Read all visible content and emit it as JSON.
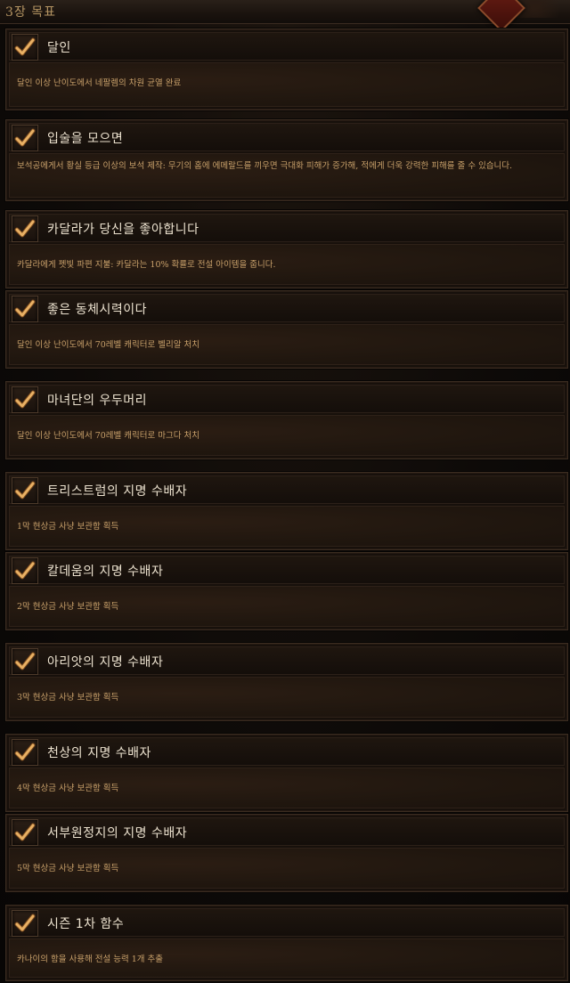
{
  "header": {
    "title": "3장 목표"
  },
  "objectives": [
    {
      "title": "달인",
      "description": "달인 이상 난이도에서 네팔렘의 차원 균열 완료",
      "completed": true,
      "check_icon": "check-icon"
    },
    {
      "title": "입술을 모으면",
      "description": "보석공에게서 황실 등급 이상의 보석 제작: 무기의 홈에 에메랄드를 끼우면 극대화 피해가 증가해, 적에게 더욱 강력한 피해를 줄 수 있습니다.",
      "completed": true,
      "check_icon": "check-icon"
    },
    {
      "title": "카달라가 당신을 좋아합니다",
      "description": "카달라에게 펫빛 파편 지불: 카달라는 10% 확률로 전설 아이템을 줍니다.",
      "completed": true,
      "check_icon": "check-icon"
    },
    {
      "title": "좋은 동체시력이다",
      "description": "달인 이상 난이도에서 70레벨 캐릭터로 벨리알 처치",
      "completed": true,
      "check_icon": "check-icon"
    },
    {
      "title": "마녀단의 우두머리",
      "description": "달인 이상 난이도에서 70레벨 캐릭터로 마그다 처치",
      "completed": true,
      "check_icon": "check-icon"
    },
    {
      "title": "트리스트럼의 지명 수배자",
      "description": "1막 현상금 사냥 보관함 획득",
      "completed": true,
      "check_icon": "check-icon"
    },
    {
      "title": "칼데움의 지명 수배자",
      "description": "2막 현상금 사냥 보관함 획득",
      "completed": true,
      "check_icon": "check-icon"
    },
    {
      "title": "아리앗의 지명 수배자",
      "description": "3막 현상금 사냥 보관함 획득",
      "completed": true,
      "check_icon": "check-icon"
    },
    {
      "title": "천상의 지명 수배자",
      "description": "4막 현상금 사냥 보관함 획득",
      "completed": true,
      "check_icon": "check-icon"
    },
    {
      "title": "서부원정지의 지명 수배자",
      "description": "5막 현상금 사냥 보관함 획득",
      "completed": true,
      "check_icon": "check-icon"
    },
    {
      "title": "시즌 1차 함수",
      "description": "카나이의 함을 사용해 전설 능력 1개 추출",
      "completed": true,
      "check_icon": "check-icon"
    }
  ],
  "colors": {
    "title_text": "#ece2cf",
    "description_text": "#c8a06a",
    "header_text": "#b49462",
    "check_mark": "#e0a85a"
  }
}
